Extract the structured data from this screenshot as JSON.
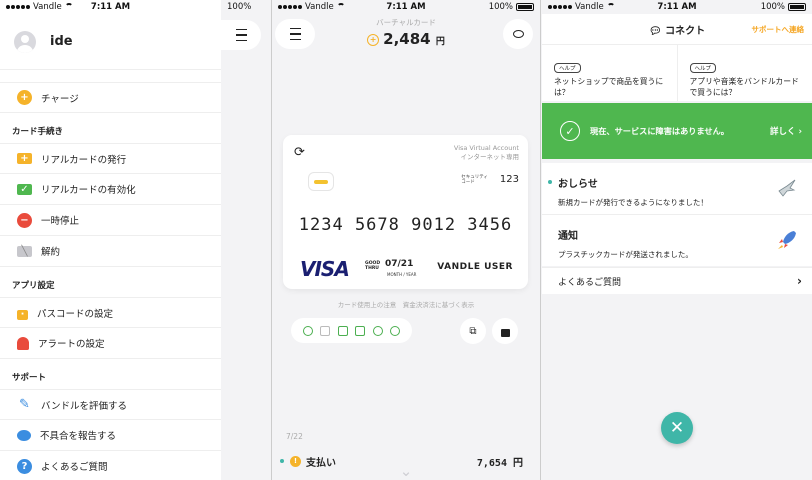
{
  "status": {
    "carrier": "Vandle",
    "time": "7:11 AM",
    "battery": "100%"
  },
  "menu": {
    "user_name": "ide",
    "charge": "チャージ",
    "section_card": "カード手続き",
    "card_items": [
      "リアルカードの発行",
      "リアルカードの有効化",
      "一時停止",
      "解約"
    ],
    "section_app": "アプリ設定",
    "app_items": [
      "パスコードの設定",
      "アラートの設定"
    ],
    "section_support": "サポート",
    "support_items": [
      "バンドルを評価する",
      "不具合を報告する",
      "よくあるご質問"
    ]
  },
  "wallet": {
    "balance_label": "バーチャルカード",
    "balance": "2,484",
    "currency": "円",
    "card": {
      "type_line1": "Visa Virtual Account",
      "type_line2": "インターネット専用",
      "security_label": "セキュリティ\nコード",
      "cvv": "123",
      "number": "1234 5678 9012 3456",
      "brand": "VISA",
      "good_thru": "GOOD\nTHRU",
      "expiry": "07/21",
      "month_year": "MONTH / YEAR",
      "holder": "VANDLE USER"
    },
    "notes": "カード使用上の注意　資金決済法に基づく表示",
    "date": "7/22",
    "tx_label": "支払い",
    "tx_amount": "7,654 円"
  },
  "connect": {
    "title": "コネクト",
    "support_link": "サポートへ連絡",
    "help_tag": "ヘルプ",
    "help_items": [
      "ネットショップで商品を買うには？",
      "アプリや音楽をバンドルカードで買うには？"
    ],
    "banner_msg": "現在、サービスに障害はありません。",
    "banner_more": "詳しく",
    "news_title": "おしらせ",
    "news_body": "新規カードが発行できるようになりました！",
    "notice_title": "通知",
    "notice_body": "プラスチックカードが発送されました。",
    "faq": "よくあるご質問"
  },
  "colors": {
    "accent": "#3fb6a8",
    "success": "#4fb74f",
    "warning": "#f5b32a",
    "danger": "#e94b3c"
  }
}
